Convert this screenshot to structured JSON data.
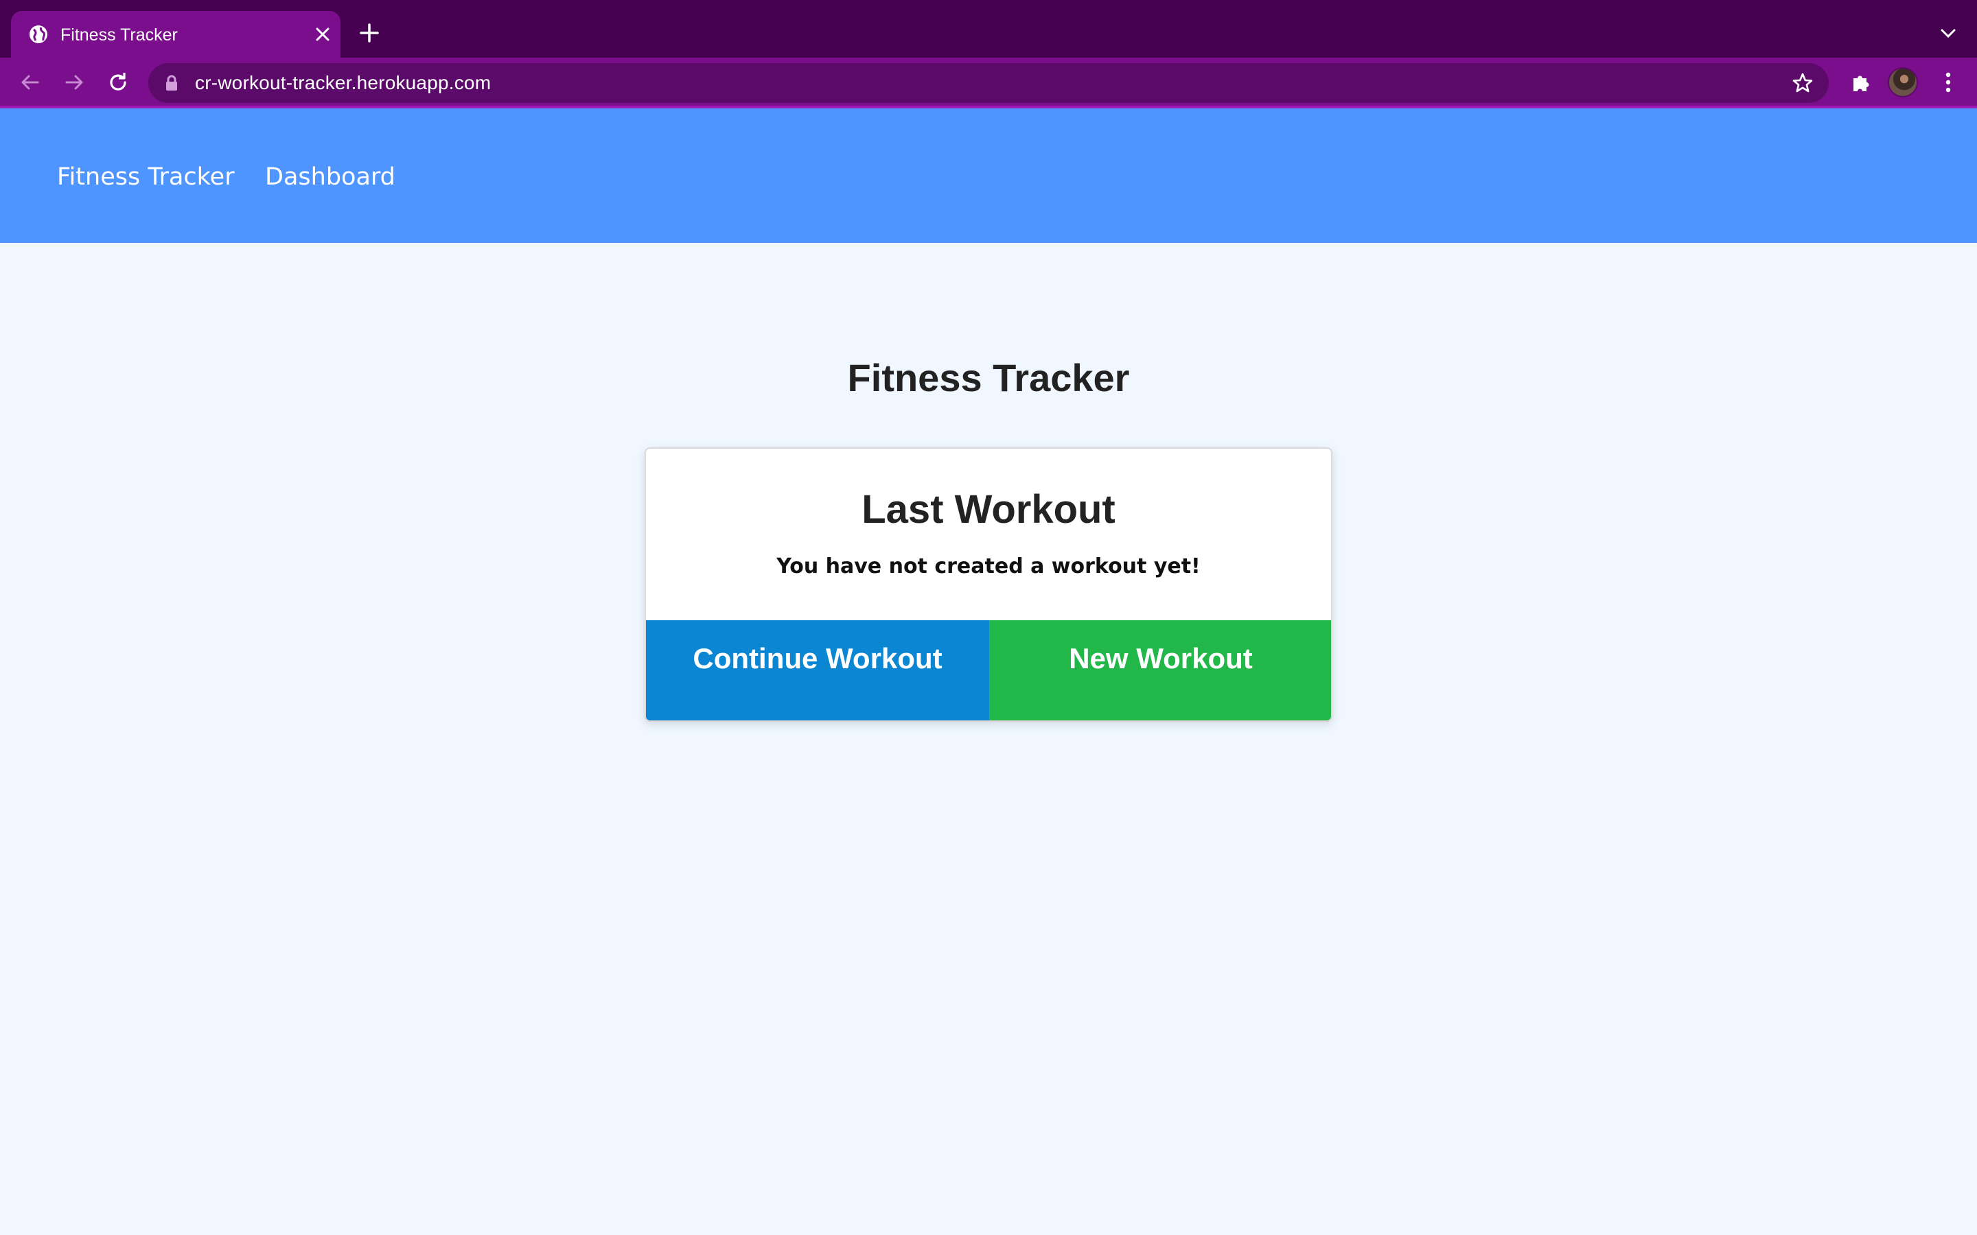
{
  "browser": {
    "tab": {
      "title": "Fitness Tracker",
      "favicon": "globe-icon",
      "close_icon": "close-icon"
    },
    "new_tab_icon": "plus-icon",
    "tab_search_icon": "chevron-down-icon",
    "toolbar": {
      "back_icon": "arrow-left-icon",
      "forward_icon": "arrow-right-icon",
      "reload_icon": "reload-icon",
      "url": "cr-workout-tracker.herokuapp.com",
      "lock_icon": "lock-icon",
      "bookmark_icon": "star-icon",
      "extensions_icon": "puzzle-icon",
      "menu_icon": "kebab-menu-icon"
    },
    "colors": {
      "tabstrip": "#450050",
      "toolbar": "#7a0e8c",
      "omnibox": "#5c0a69"
    }
  },
  "navbar": {
    "brand": "Fitness Tracker",
    "links": [
      "Dashboard"
    ],
    "color": "#4f95ff"
  },
  "main": {
    "title": "Fitness Tracker",
    "card": {
      "title": "Last Workout",
      "message": "You have not created a workout yet!",
      "continue_label": "Continue Workout",
      "new_label": "New Workout",
      "continue_color": "#0b86d2",
      "new_color": "#21b749"
    }
  }
}
